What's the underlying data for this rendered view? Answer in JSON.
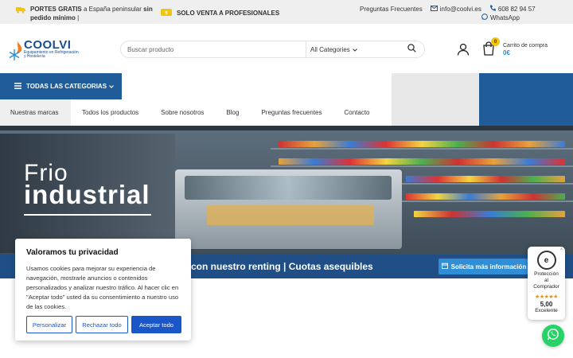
{
  "topbar": {
    "promo_bold1": "PORTES GRATIS",
    "promo_mid": " a España peninsular ",
    "promo_bold2": "sin pedido mínimo",
    "promo_end": " |",
    "pro_label": "SOLO VENTA A PROFESIONALES",
    "faq_label": "Preguntas Frecuentes",
    "email": "info@coolvi.es",
    "phone": "608 82 94 57",
    "whatsapp": "WhatsApp"
  },
  "header": {
    "logo_word": "COOLVI",
    "logo_tag": "Equipamiento en Refrigeración y Hostelería",
    "search_placeholder": "Buscar producto",
    "category_select": "All Categories",
    "cart_count": "0",
    "cart_label": "Carrito de compra",
    "cart_amount": "0€"
  },
  "nav": {
    "all_categories": "TODAS LAS CATEGORIAS",
    "items": [
      "Nuestras marcas",
      "Todos los productos",
      "Sobre nosotros",
      "Blog",
      "Preguntas frecuentes",
      "Contacto"
    ]
  },
  "hero": {
    "line1": "Frio",
    "line2": "industrial"
  },
  "renting": {
    "text": "con nuestro renting | Cuotas asequibles",
    "button": "Solicita más información"
  },
  "cookie": {
    "title": "Valoramos tu privacidad",
    "body": "Usamos cookies para mejorar su experiencia de navegación, mostrarle anuncios o contenidos personalizados y analizar nuestro tráfico. Al hacer clic en \"Aceptar todo\" usted da su consentimiento a nuestro uso de las cookies.",
    "personalize": "Personalizar",
    "reject": "Rechazar todo",
    "accept": "Aceptar todo"
  },
  "trusted": {
    "seal": "e",
    "label1": "Protección",
    "label2": "al",
    "label3": "Comprador",
    "stars": "★★★★★",
    "score": "5,00",
    "rating_word": "Excelente",
    "close": "^"
  },
  "colors": {
    "brand_blue": "#1f5c99",
    "accent_blue": "#1a56c8",
    "whatsapp_green": "#25d366"
  }
}
